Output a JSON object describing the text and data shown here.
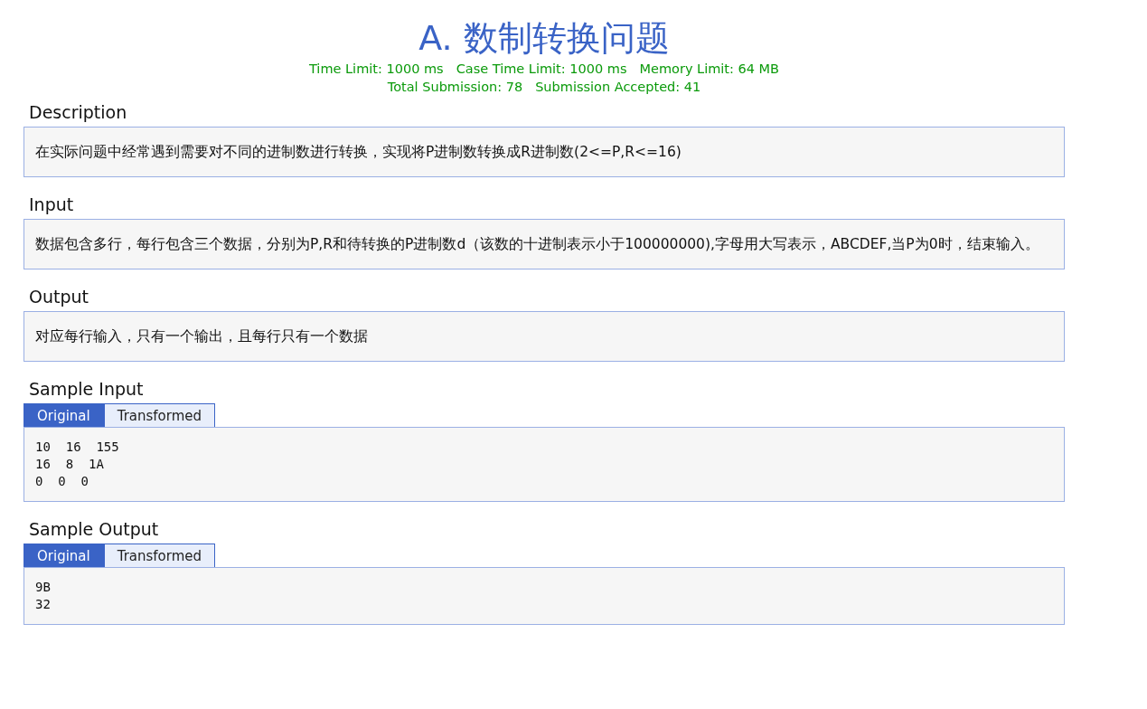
{
  "title": "A. 数制转换问题",
  "limits": [
    {
      "label": "Time Limit: 1000 ms"
    },
    {
      "label": "Case Time Limit: 1000 ms"
    },
    {
      "label": "Memory Limit: 64 MB"
    }
  ],
  "stats": [
    {
      "label": "Total Submission: 78"
    },
    {
      "label": "Submission Accepted: 41"
    }
  ],
  "sections": [
    {
      "kind": "text",
      "heading": "Description",
      "body": "在实际问题中经常遇到需要对不同的进制数进行转换，实现将P进制数转换成R进制数(2<=P,R<=16)"
    },
    {
      "kind": "text",
      "heading": "Input",
      "body": "数据包含多行，每行包含三个数据，分别为P,R和待转换的P进制数d（该数的十进制表示小于100000000),字母用大写表示，ABCDEF,当P为0时，结束输入。"
    },
    {
      "kind": "text",
      "heading": "Output",
      "body": "对应每行输入，只有一个输出，且每行只有一个数据"
    },
    {
      "kind": "sample",
      "heading": "Sample Input",
      "tabs": [
        {
          "label": "Original",
          "selected": true
        },
        {
          "label": "Transformed",
          "selected": false
        }
      ],
      "body": "10  16  155\n16  8  1A\n0  0  0"
    },
    {
      "kind": "sample",
      "heading": "Sample Output",
      "tabs": [
        {
          "label": "Original",
          "selected": true
        },
        {
          "label": "Transformed",
          "selected": false
        }
      ],
      "body": "9B\n32"
    }
  ]
}
